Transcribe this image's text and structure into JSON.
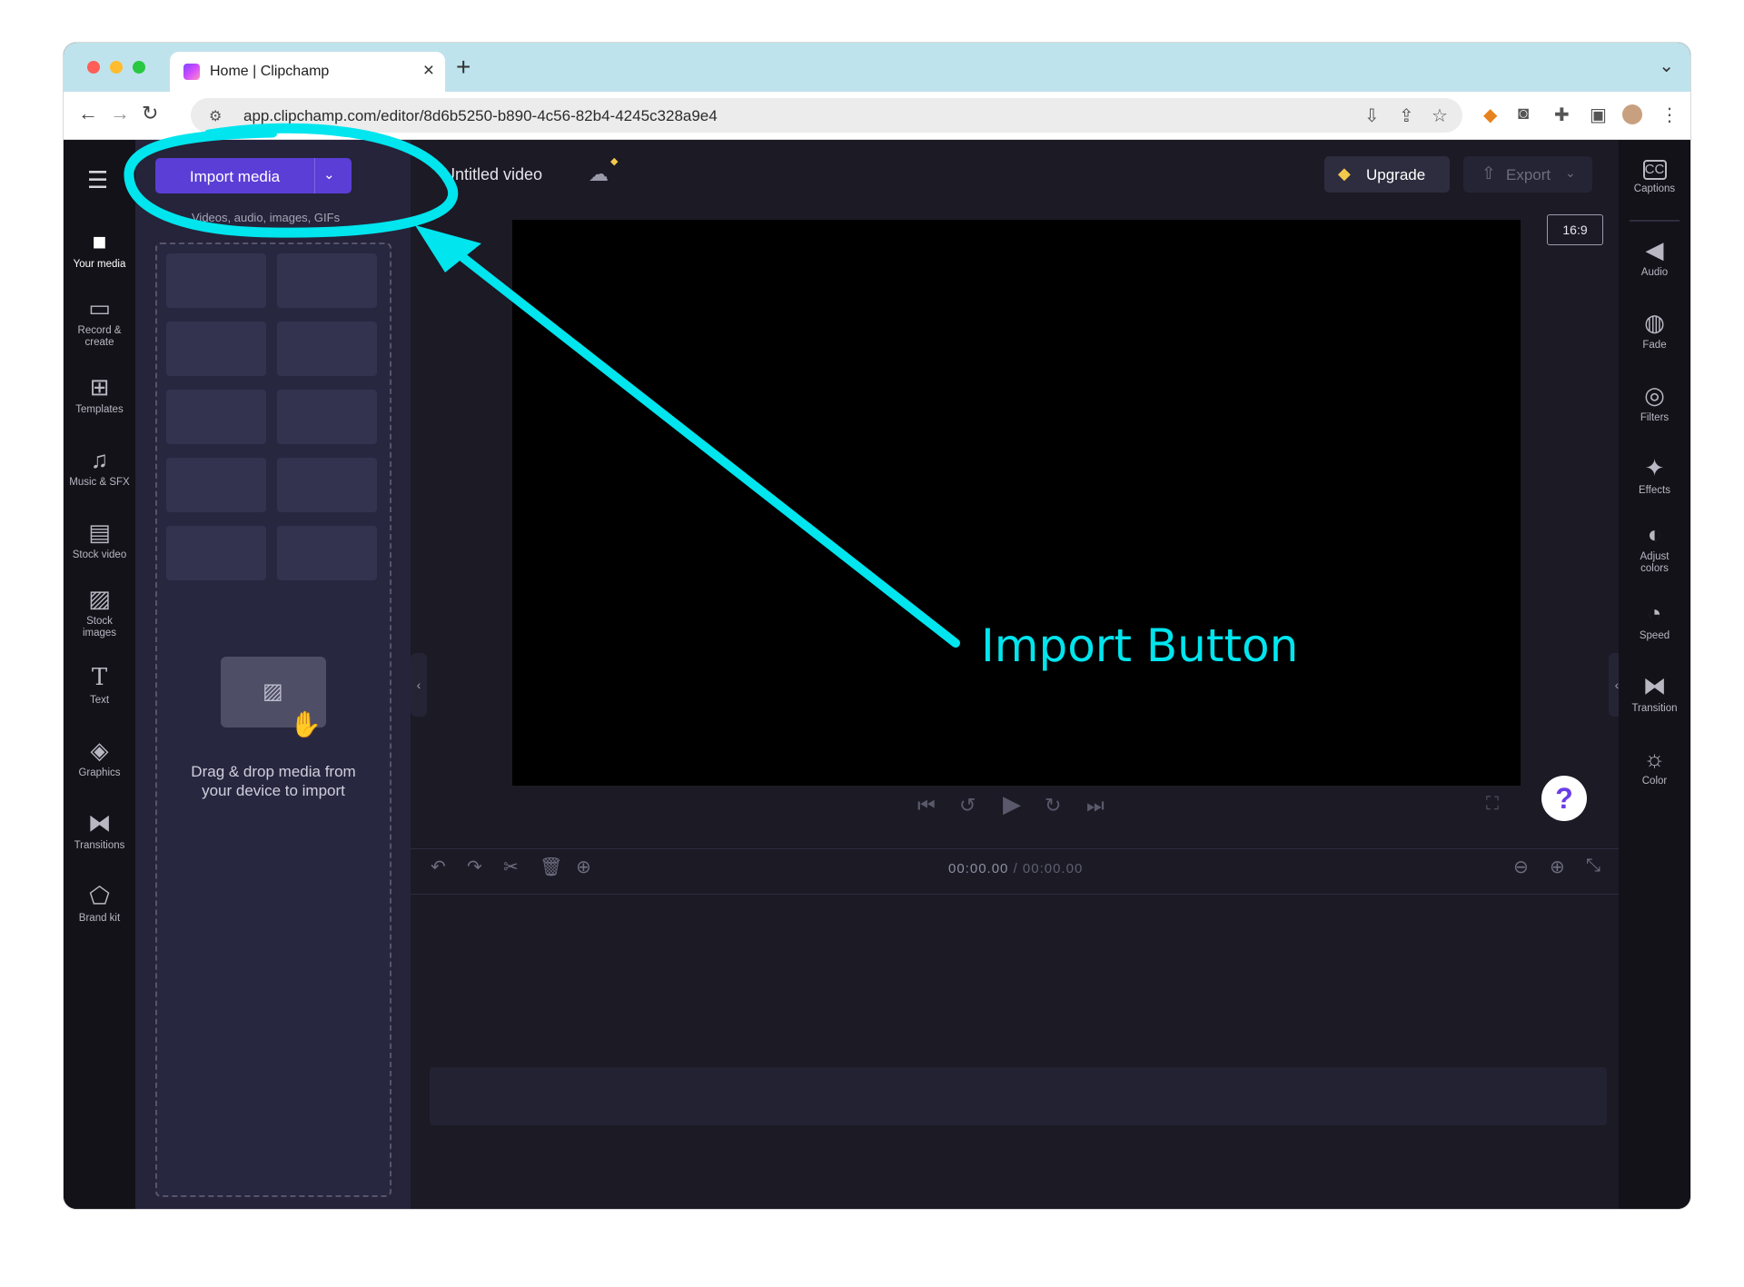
{
  "browser": {
    "tab_title": "Home | Clipchamp",
    "tab_close": "×",
    "new_tab": "+",
    "url": "app.clipchamp.com/editor/8d6b5250-b890-4c56-82b4-4245c328a9e4"
  },
  "editor": {
    "import_button_label": "Import media",
    "import_subtitle": "Videos, audio, images, GIFs",
    "drop_text_line1": "Drag & drop media from",
    "drop_text_line2": "your device to import",
    "project_title": "Untitled video",
    "upgrade_label": "Upgrade",
    "export_label": "Export",
    "aspect_ratio": "16:9",
    "help_label": "?",
    "timecode_current": "00:00.00",
    "timecode_total": "/ 00:00.00"
  },
  "left_nav": [
    {
      "label": "Your media",
      "icon": "folder-icon"
    },
    {
      "label": "Record & create",
      "icon": "camera-icon"
    },
    {
      "label": "Templates",
      "icon": "templates-icon"
    },
    {
      "label": "Music & SFX",
      "icon": "music-icon"
    },
    {
      "label": "Stock video",
      "icon": "film-icon"
    },
    {
      "label": "Stock images",
      "icon": "image-icon"
    },
    {
      "label": "Text",
      "icon": "text-icon"
    },
    {
      "label": "Graphics",
      "icon": "shapes-icon"
    },
    {
      "label": "Transitions",
      "icon": "transition-icon"
    },
    {
      "label": "Brand kit",
      "icon": "brand-icon"
    }
  ],
  "right_nav": [
    {
      "label": "Captions",
      "icon": "cc-icon"
    },
    {
      "label": "Audio",
      "icon": "speaker-icon"
    },
    {
      "label": "Fade",
      "icon": "fade-icon"
    },
    {
      "label": "Filters",
      "icon": "filters-icon"
    },
    {
      "label": "Effects",
      "icon": "magic-wand-icon"
    },
    {
      "label": "Adjust colors",
      "icon": "contrast-icon"
    },
    {
      "label": "Speed",
      "icon": "speedometer-icon"
    },
    {
      "label": "Transition",
      "icon": "transition-icon"
    },
    {
      "label": "Color",
      "icon": "palette-icon"
    }
  ],
  "annotation": {
    "text": "Import Button",
    "color": "#00e5ee"
  },
  "colors": {
    "accent": "#5b3ed6",
    "app_bg": "#1b1a25",
    "tab_strip": "#bfe3ec"
  }
}
